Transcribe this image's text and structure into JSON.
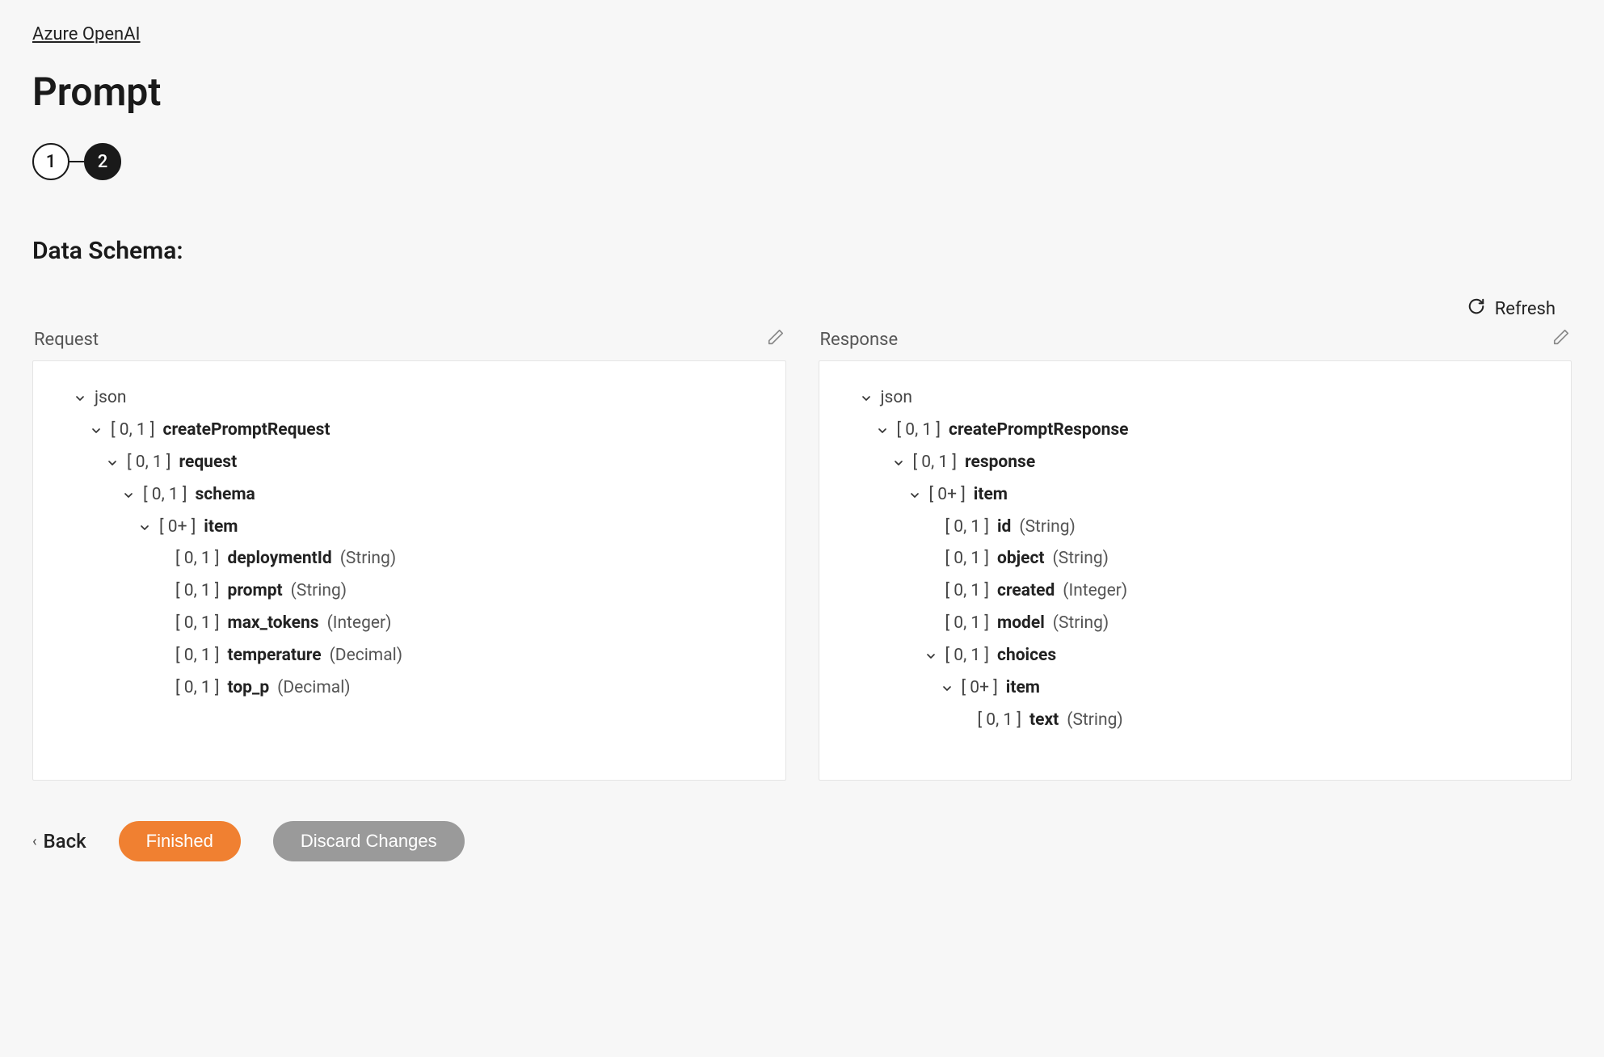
{
  "breadcrumb": "Azure OpenAI",
  "title": "Prompt",
  "stepper": {
    "steps": [
      "1",
      "2"
    ],
    "active_index": 1
  },
  "section_title": "Data Schema:",
  "refresh_label": "Refresh",
  "panels": {
    "request": {
      "label": "Request",
      "tree": [
        {
          "indent": 0,
          "chevron": true,
          "card": "",
          "name": "json",
          "type": "",
          "name_bold": false
        },
        {
          "indent": 1,
          "chevron": true,
          "card": "[ 0, 1 ]",
          "name": "createPromptRequest",
          "type": ""
        },
        {
          "indent": 2,
          "chevron": true,
          "card": "[ 0, 1 ]",
          "name": "request",
          "type": ""
        },
        {
          "indent": 3,
          "chevron": true,
          "card": "[ 0, 1 ]",
          "name": "schema",
          "type": ""
        },
        {
          "indent": 4,
          "chevron": true,
          "card": "[ 0+ ]",
          "name": "item",
          "type": ""
        },
        {
          "indent": 5,
          "chevron": false,
          "card": "[ 0, 1 ]",
          "name": "deploymentId",
          "type": "(String)"
        },
        {
          "indent": 5,
          "chevron": false,
          "card": "[ 0, 1 ]",
          "name": "prompt",
          "type": "(String)"
        },
        {
          "indent": 5,
          "chevron": false,
          "card": "[ 0, 1 ]",
          "name": "max_tokens",
          "type": "(Integer)"
        },
        {
          "indent": 5,
          "chevron": false,
          "card": "[ 0, 1 ]",
          "name": "temperature",
          "type": "(Decimal)"
        },
        {
          "indent": 5,
          "chevron": false,
          "card": "[ 0, 1 ]",
          "name": "top_p",
          "type": "(Decimal)"
        }
      ]
    },
    "response": {
      "label": "Response",
      "tree": [
        {
          "indent": 0,
          "chevron": true,
          "card": "",
          "name": "json",
          "type": "",
          "name_bold": false
        },
        {
          "indent": 1,
          "chevron": true,
          "card": "[ 0, 1 ]",
          "name": "createPromptResponse",
          "type": ""
        },
        {
          "indent": 2,
          "chevron": true,
          "card": "[ 0, 1 ]",
          "name": "response",
          "type": ""
        },
        {
          "indent": 3,
          "chevron": true,
          "card": "[ 0+ ]",
          "name": "item",
          "type": ""
        },
        {
          "indent": 4,
          "chevron": false,
          "card": "[ 0, 1 ]",
          "name": "id",
          "type": "(String)"
        },
        {
          "indent": 4,
          "chevron": false,
          "card": "[ 0, 1 ]",
          "name": "object",
          "type": "(String)"
        },
        {
          "indent": 4,
          "chevron": false,
          "card": "[ 0, 1 ]",
          "name": "created",
          "type": "(Integer)"
        },
        {
          "indent": 4,
          "chevron": false,
          "card": "[ 0, 1 ]",
          "name": "model",
          "type": "(String)"
        },
        {
          "indent": 4,
          "chevron": true,
          "card": "[ 0, 1 ]",
          "name": "choices",
          "type": ""
        },
        {
          "indent": 5,
          "chevron": true,
          "card": "[ 0+ ]",
          "name": "item",
          "type": ""
        },
        {
          "indent": 6,
          "chevron": false,
          "card": "[ 0, 1 ]",
          "name": "text",
          "type": "(String)"
        }
      ]
    }
  },
  "footer": {
    "back": "Back",
    "finished": "Finished",
    "discard": "Discard Changes"
  }
}
